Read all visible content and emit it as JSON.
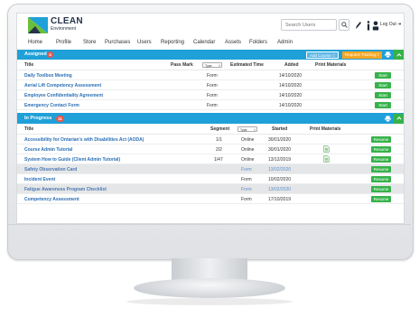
{
  "header": {
    "logo_text": "CLEAN",
    "logo_subtext": "Environment",
    "search_placeholder": "Search Users",
    "logout_label": "Log Out",
    "brand_colors": {
      "primary": "#1fa0d8",
      "dark": "#27344a",
      "logo_green": "#6abf3a"
    }
  },
  "nav": {
    "items": [
      "Home",
      "Profile",
      "Store",
      "Purchases",
      "Users",
      "Reporting",
      "Calendar",
      "Assets",
      "Folders",
      "Admin"
    ]
  },
  "assigned": {
    "title": "Assigned",
    "count": "4",
    "add_course_label": "Add Course",
    "request_training_label": "Request Training",
    "columns": {
      "title": "Title",
      "pass_mark": "Pass Mark",
      "type_select": "Type",
      "estimated_time": "Estimated Time",
      "added": "Added",
      "print_materials": "Print Materials"
    },
    "rows": [
      {
        "title": "Daily Toolbox Meeting",
        "type": "Form",
        "added": "14/10/2020",
        "action": "Start"
      },
      {
        "title": "Aerial Lift Competency Assessment",
        "type": "Form",
        "added": "14/10/2020",
        "action": "Start"
      },
      {
        "title": "Employee Confidentiality Agreement",
        "type": "Form",
        "added": "14/10/2020",
        "action": "Start"
      },
      {
        "title": "Emergency Contact Form",
        "type": "Form",
        "added": "14/10/2020",
        "action": "Start"
      }
    ]
  },
  "in_progress": {
    "title": "In Progress",
    "count": "11",
    "columns": {
      "title": "Title",
      "segment": "Segment",
      "type_select": "Type",
      "started": "Started",
      "print_materials": "Print Materials"
    },
    "rows": [
      {
        "title": "Accessibility for Ontarian's with Disabilities Act (AODA)",
        "segment": "1/1",
        "type": "Online",
        "started": "30/01/2020",
        "has_print": false,
        "action": "Resume"
      },
      {
        "title": "Course Admin Tutorial",
        "segment": "2/2",
        "type": "Online",
        "started": "30/01/2020",
        "has_print": true,
        "action": "Resume"
      },
      {
        "title": "System How to Guide (Client Admin Tutorial)",
        "segment": "1/47",
        "type": "Online",
        "started": "13/12/2019",
        "has_print": true,
        "action": "Resume"
      },
      {
        "title": "Safety Observation Card",
        "segment": "",
        "type": "Form",
        "started": "13/02/2020",
        "has_print": false,
        "action": "Resume",
        "highlight": true
      },
      {
        "title": "Incident Event",
        "segment": "",
        "type": "Form",
        "started": "10/02/2020",
        "has_print": false,
        "action": "Resume"
      },
      {
        "title": "Fatigue Awareness Program Checklist",
        "segment": "",
        "type": "Form",
        "started": "13/02/2020",
        "has_print": false,
        "action": "Resume",
        "highlight": true
      },
      {
        "title": "Competency Assessment",
        "segment": "",
        "type": "Form",
        "started": "17/10/2019",
        "has_print": false,
        "action": "Resume"
      }
    ]
  }
}
